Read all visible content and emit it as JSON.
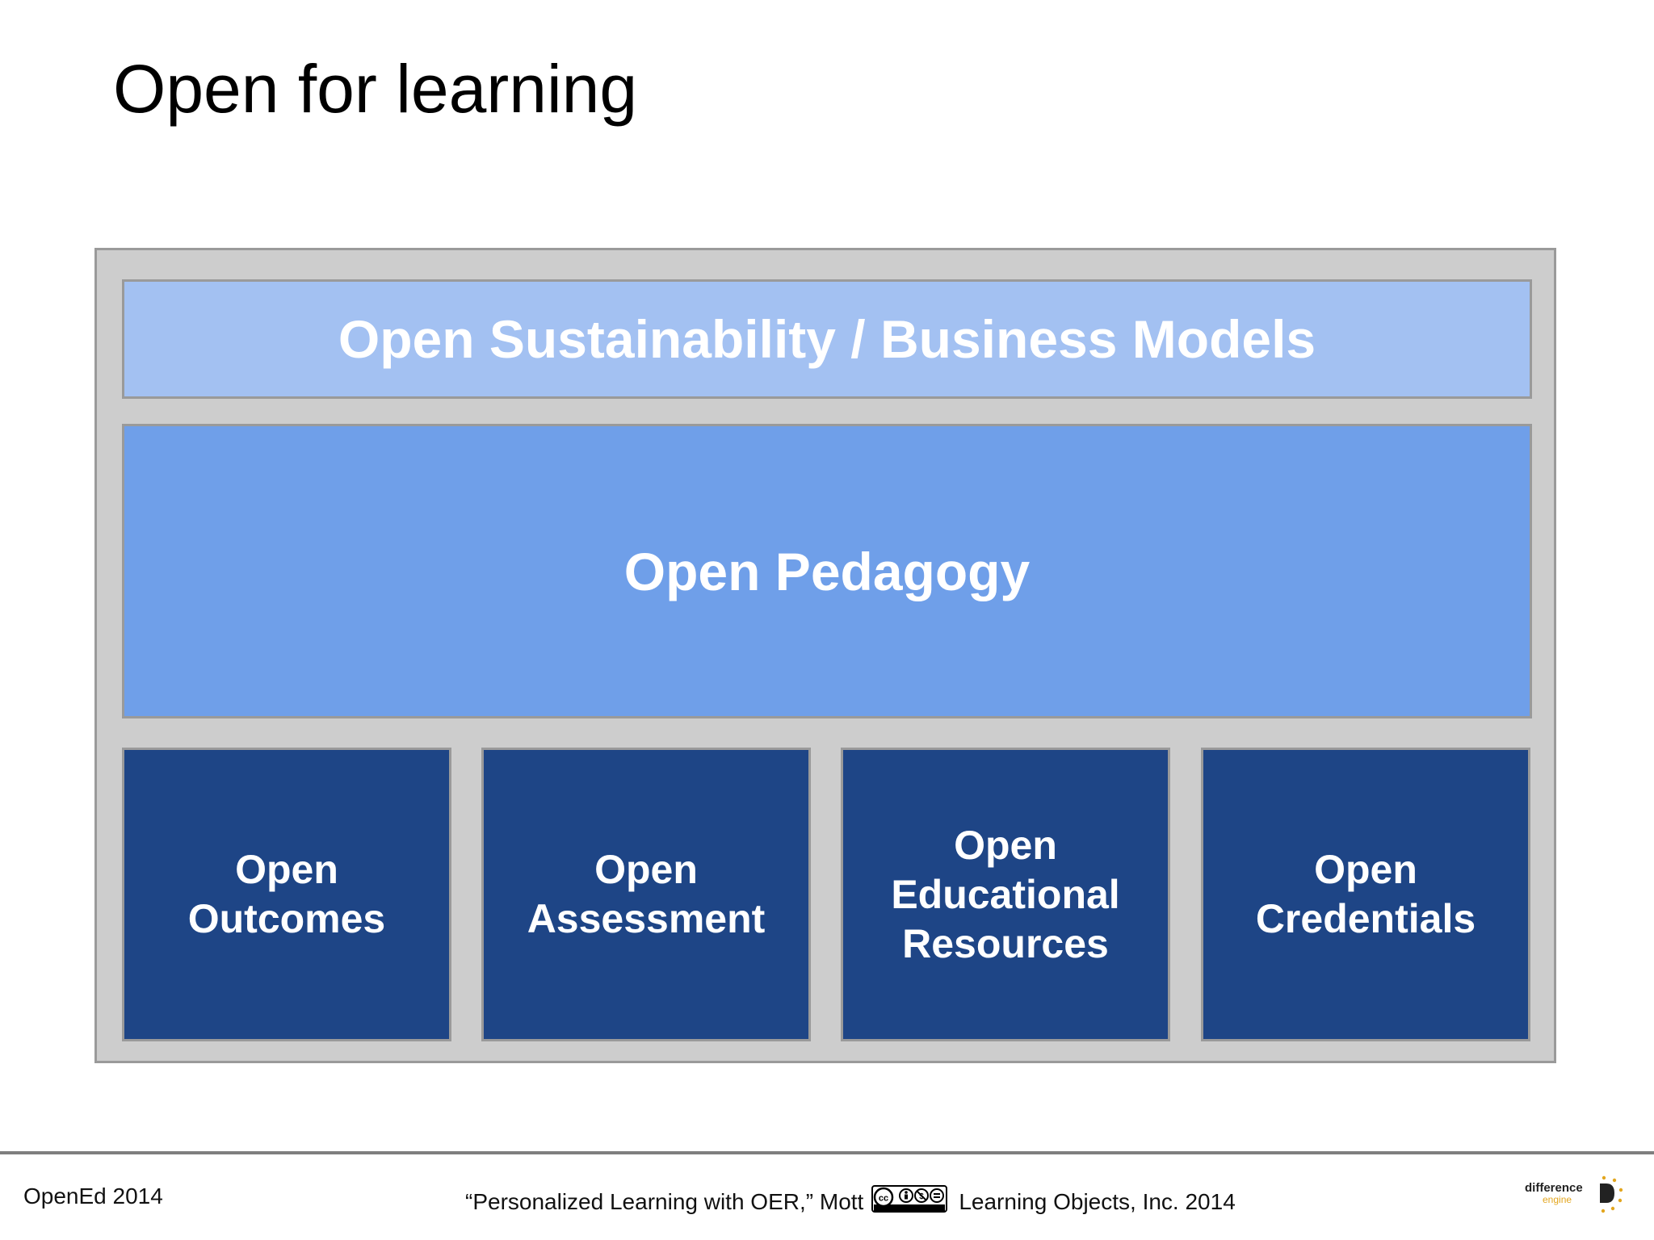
{
  "slide": {
    "title": "Open for learning"
  },
  "diagram": {
    "top_band": "Open Sustainability / Business Models",
    "middle_band": "Open Pedagogy",
    "pillars": [
      "Open\nOutcomes",
      "Open\nAssessment",
      "Open\nEducational\nResources",
      "Open\nCredentials"
    ]
  },
  "footer": {
    "left": "OpenEd 2014",
    "citation": "“Personalized Learning with OER,” Mott",
    "license_icon": "cc-by-nc-nd-icon",
    "copyright": "Learning Objects, Inc. 2014",
    "logo_line1": "difference",
    "logo_line2": "engine"
  },
  "colors": {
    "frame": "#cdcdcd",
    "top_band": "#a3c1f2",
    "middle_band": "#6f9fe9",
    "pillar": "#1e4586"
  }
}
